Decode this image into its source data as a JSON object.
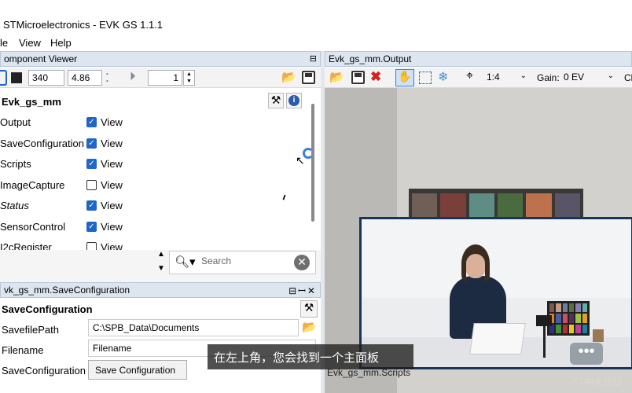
{
  "window": {
    "title": "STMicroelectronics - EVK GS 1.1.1"
  },
  "menu": [
    "le",
    "View",
    "Help"
  ],
  "component_viewer": {
    "header": "omponent Viewer",
    "toolbar": {
      "value1": "340",
      "value2": "4.86",
      "frame": "1"
    },
    "root": "Evk_gs_mm",
    "rows": [
      {
        "label": "Output",
        "checked": true,
        "italic": false
      },
      {
        "label": "SaveConfiguration",
        "checked": true,
        "italic": false
      },
      {
        "label": "Scripts",
        "checked": true,
        "italic": false
      },
      {
        "label": "ImageCapture",
        "checked": false,
        "italic": false
      },
      {
        "label": "Status",
        "checked": true,
        "italic": true
      },
      {
        "label": "SensorControl",
        "checked": true,
        "italic": false
      },
      {
        "label": "I2cRegister",
        "checked": false,
        "italic": false
      }
    ],
    "view_label": "View",
    "search_placeholder": "Search"
  },
  "save_config": {
    "header": "vk_gs_mm.SaveConfiguration",
    "root": "SaveConfiguration",
    "path_label": "SavefilePath",
    "path_value": "C:\\SPB_Data\\Documents",
    "filename_label": "Filename",
    "filename_value": "Filename",
    "button_row_label": "SaveConfiguration",
    "button_label": "Save Configuration"
  },
  "output_panel": {
    "header": "Evk_gs_mm.Output",
    "zoom": "1:4",
    "gain_label": "Gain:",
    "gain_value": "0 EV",
    "trailing": "Cl",
    "scripts_tab": "Evk_gs_mm.Scripts"
  },
  "video_subtitle": "在左上角，您会找到一个主面板",
  "watermark": "ST中文论坛",
  "colors": {
    "accent": "#1f66c9",
    "panel_header": "#dde5ef",
    "pip_border": "#17365a"
  }
}
